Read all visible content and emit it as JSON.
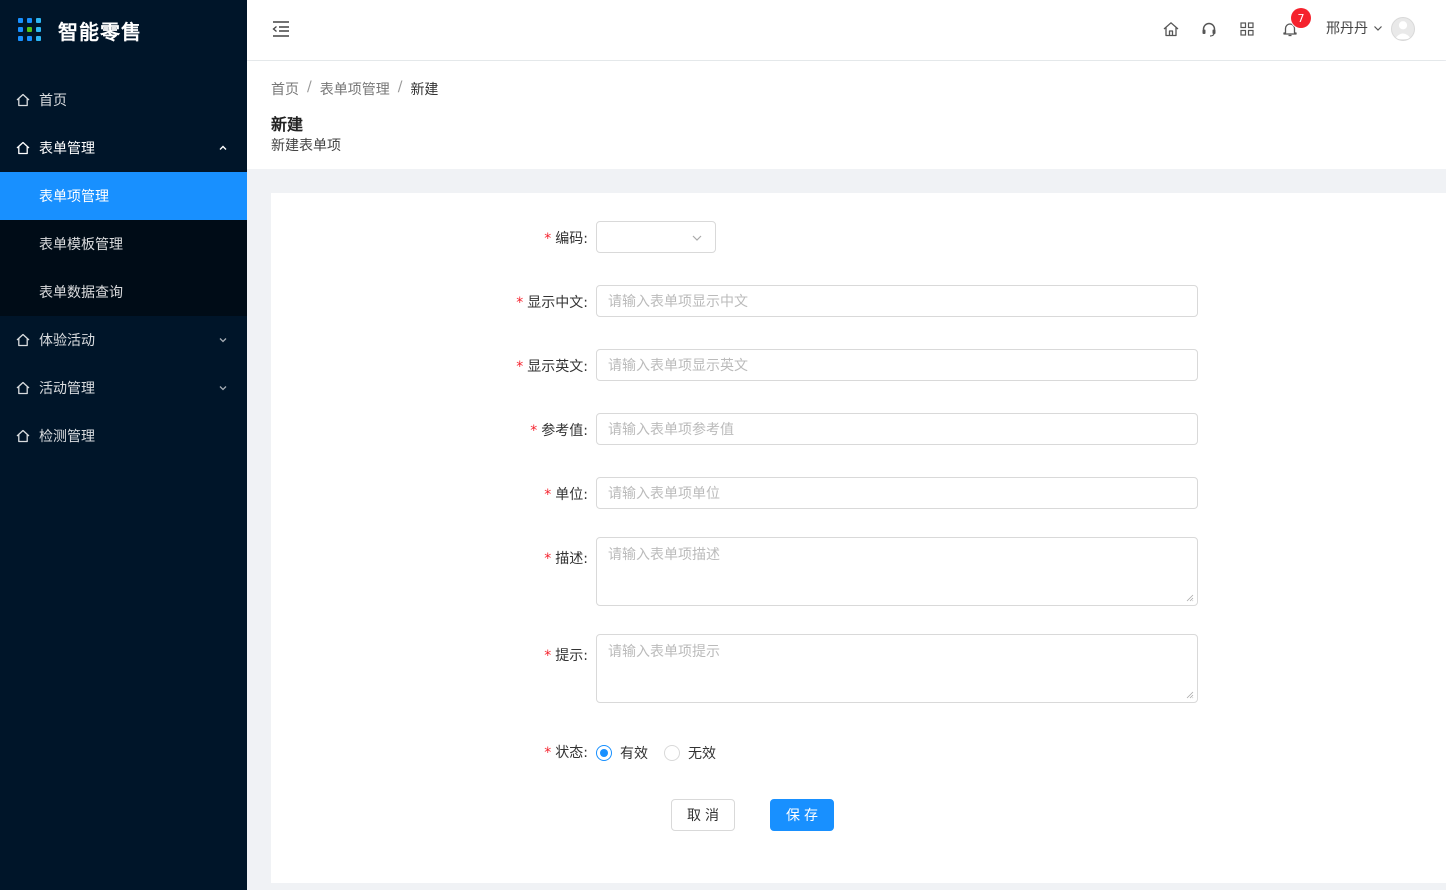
{
  "app": {
    "title": "智能零售"
  },
  "sidebar": {
    "items": [
      {
        "label": "首页"
      },
      {
        "label": "表单管理"
      },
      {
        "label": "体验活动"
      },
      {
        "label": "活动管理"
      },
      {
        "label": "检测管理"
      }
    ],
    "submenu": [
      {
        "label": "表单项管理"
      },
      {
        "label": "表单模板管理"
      },
      {
        "label": "表单数据查询"
      }
    ]
  },
  "header": {
    "notification_count": "7",
    "username": "邢丹丹"
  },
  "breadcrumb": {
    "items": [
      "首页",
      "表单项管理",
      "新建"
    ],
    "separator": "/"
  },
  "page": {
    "title": "新建",
    "subtitle": "新建表单项"
  },
  "form": {
    "required_mark": "*",
    "code": {
      "label": "编码:"
    },
    "name_cn": {
      "label": "显示中文:",
      "placeholder": "请输入表单项显示中文"
    },
    "name_en": {
      "label": "显示英文:",
      "placeholder": "请输入表单项显示英文"
    },
    "ref_value": {
      "label": "参考值:",
      "placeholder": "请输入表单项参考值"
    },
    "unit": {
      "label": "单位:",
      "placeholder": "请输入表单项单位"
    },
    "description": {
      "label": "描述:",
      "placeholder": "请输入表单项描述"
    },
    "hint": {
      "label": "提示:",
      "placeholder": "请输入表单项提示"
    },
    "status": {
      "label": "状态:",
      "options": [
        "有效",
        "无效"
      ],
      "selected": "有效"
    },
    "cancel_label": "取消",
    "save_label": "保存"
  },
  "colors": {
    "sidebar_bg": "#001529",
    "submenu_bg": "#000c17",
    "primary": "#1890ff",
    "required": "#f5222d",
    "badge": "#f5222d"
  },
  "icons": [
    "home-icon",
    "chevron-up-icon",
    "chevron-down-icon",
    "menu-fold-icon",
    "headset-icon",
    "apps-icon",
    "bell-icon",
    "user-avatar-icon"
  ]
}
